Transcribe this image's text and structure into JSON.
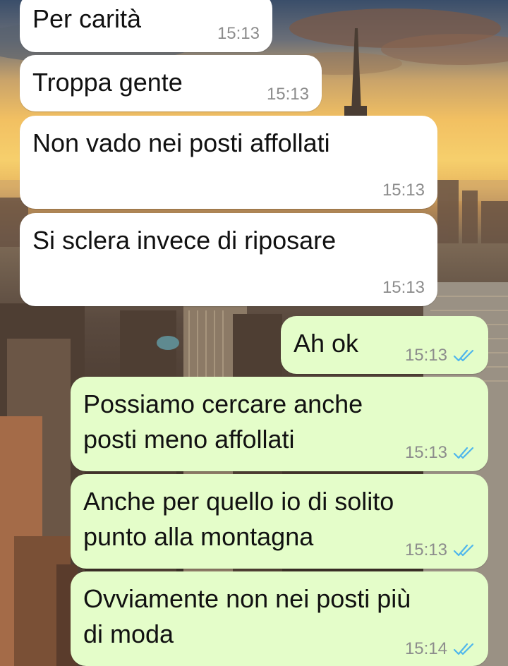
{
  "chat": {
    "messages": [
      {
        "direction": "incoming",
        "text": "Per carità",
        "time": "15:13"
      },
      {
        "direction": "incoming",
        "text": "Troppa gente",
        "time": "15:13"
      },
      {
        "direction": "incoming",
        "text": "Non vado nei posti affollati",
        "time": "15:13"
      },
      {
        "direction": "incoming",
        "text": "Si sclera invece di riposare",
        "time": "15:13"
      },
      {
        "direction": "outgoing",
        "text": "Ah ok",
        "time": "15:13",
        "status": "read"
      },
      {
        "direction": "outgoing",
        "text": "Possiamo cercare anche\nposti meno affollati",
        "time": "15:13",
        "status": "read"
      },
      {
        "direction": "outgoing",
        "text": "Anche per quello io di solito\npunto alla montagna",
        "time": "15:13",
        "status": "read"
      },
      {
        "direction": "outgoing",
        "text": "Ovviamente non nei posti più\ndi moda",
        "time": "15:14",
        "status": "read"
      }
    ]
  },
  "colors": {
    "incoming_bubble": "#ffffff",
    "outgoing_bubble": "#e4fdc9",
    "read_ticks": "#4fb6ec",
    "timestamp": "#8c8c8c"
  },
  "icons": {
    "read_receipt": "double-check-icon"
  }
}
